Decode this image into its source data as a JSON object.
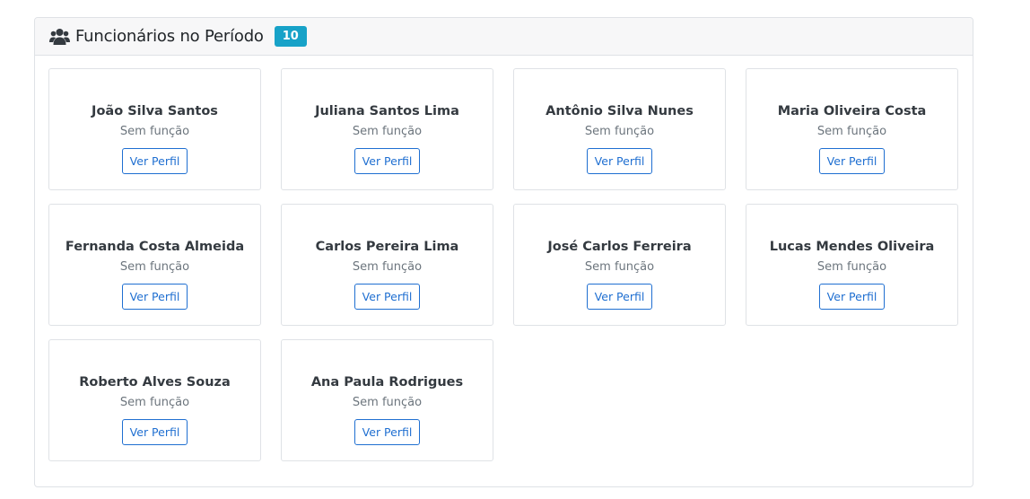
{
  "panel": {
    "title": "Funcionários no Período",
    "count": "10",
    "icon": "users-icon",
    "badge_color": "#17a2c8"
  },
  "employees": [
    {
      "name": "João Silva Santos",
      "role": "Sem função",
      "button": "Ver Perfil"
    },
    {
      "name": "Juliana Santos Lima",
      "role": "Sem função",
      "button": "Ver Perfil"
    },
    {
      "name": "Antônio Silva Nunes",
      "role": "Sem função",
      "button": "Ver Perfil"
    },
    {
      "name": "Maria Oliveira Costa",
      "role": "Sem função",
      "button": "Ver Perfil"
    },
    {
      "name": "Fernanda Costa Almeida",
      "role": "Sem função",
      "button": "Ver Perfil"
    },
    {
      "name": "Carlos Pereira Lima",
      "role": "Sem função",
      "button": "Ver Perfil"
    },
    {
      "name": "José Carlos Ferreira",
      "role": "Sem função",
      "button": "Ver Perfil"
    },
    {
      "name": "Lucas Mendes Oliveira",
      "role": "Sem função",
      "button": "Ver Perfil"
    },
    {
      "name": "Roberto Alves Souza",
      "role": "Sem função",
      "button": "Ver Perfil"
    },
    {
      "name": "Ana Paula Rodrigues",
      "role": "Sem função",
      "button": "Ver Perfil"
    }
  ],
  "colors": {
    "primary": "#1f6fd1",
    "muted_text": "#6c757d",
    "border": "#dfe2e6"
  }
}
